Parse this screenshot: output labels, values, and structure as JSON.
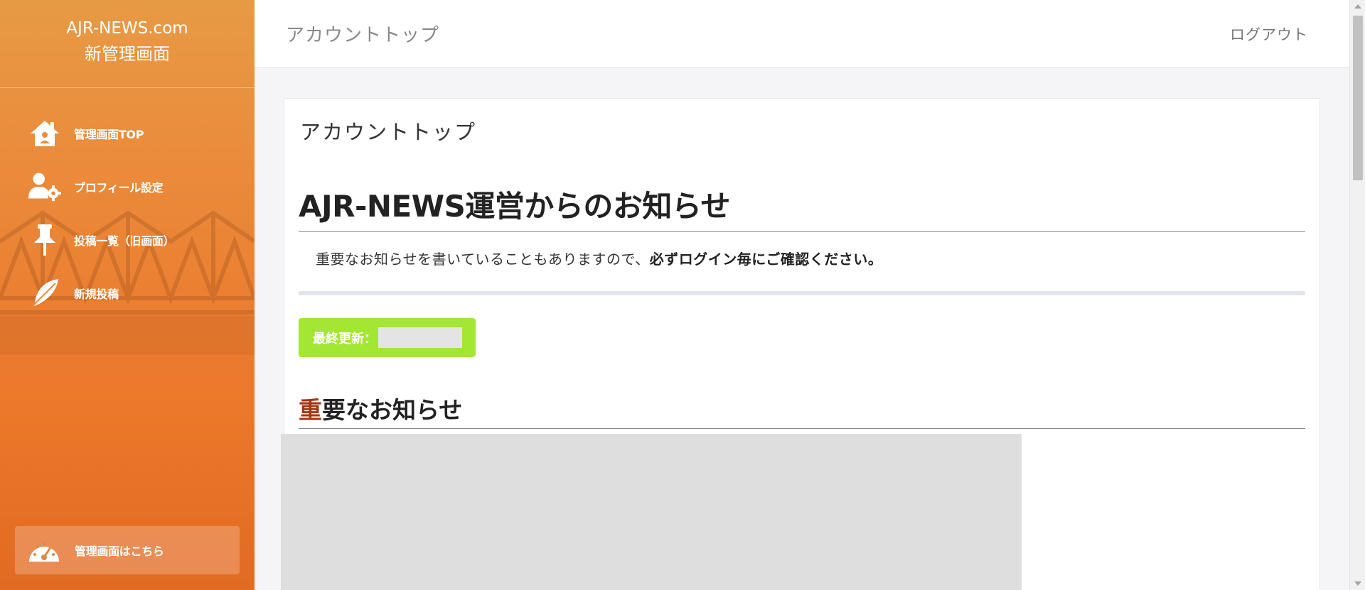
{
  "sidebar": {
    "brand_line1": "AJR-NEWS.com",
    "brand_line2": "新管理画面",
    "items": [
      {
        "label": "管理画面TOP",
        "icon": "home-icon"
      },
      {
        "label": "プロフィール設定",
        "icon": "user-gear-icon"
      },
      {
        "label": "投稿一覧（旧画面）",
        "icon": "pin-icon"
      },
      {
        "label": "新規投稿",
        "icon": "feather-icon"
      }
    ],
    "admin_link": {
      "label": "管理画面はこちら",
      "icon": "dashboard-icon"
    }
  },
  "header": {
    "title": "アカウントトップ",
    "logout_label": "ログアウト"
  },
  "content": {
    "card_title": "アカウントトップ",
    "notice_heading": "AJR-NEWS運営からのお知らせ",
    "notice_text_prefix": "重要なお知らせを書いていることもありますので、",
    "notice_text_bold": "必ずログイン毎にご確認ください。",
    "updated_label": "最終更新：",
    "important_heading_accent": "重",
    "important_heading_rest": "要なお知らせ"
  },
  "colors": {
    "sidebar_top": "#e79a44",
    "sidebar_bottom": "#ee7326",
    "badge": "#a3e634",
    "accent_char": "#a83412"
  }
}
